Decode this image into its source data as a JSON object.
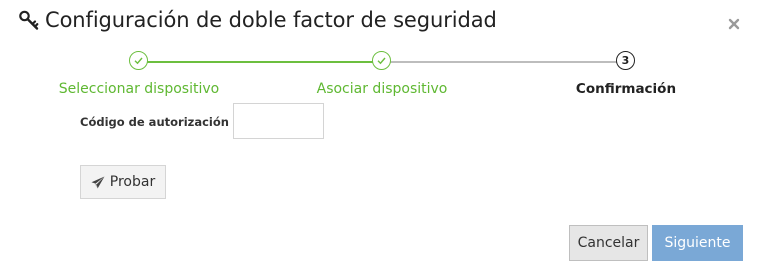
{
  "dialog": {
    "title": "Configuración de doble factor de seguridad",
    "title_icon": "key-icon",
    "close_icon": "close-icon"
  },
  "stepper": {
    "steps": [
      {
        "label": "Seleccionar dispositivo",
        "status": "completed",
        "marker": "check-icon"
      },
      {
        "label": "Asociar dispositivo",
        "status": "completed",
        "marker": "check-icon"
      },
      {
        "label": "Confirmación",
        "status": "current",
        "number": "3"
      }
    ],
    "completed_color": "#6cbf3f",
    "pending_color": "#bdbdbd"
  },
  "form": {
    "auth_code_label": "Código de autorización",
    "auth_code_value": "",
    "test_button_label": "Probar",
    "test_button_icon": "paper-plane-icon"
  },
  "footer": {
    "cancel_label": "Cancelar",
    "next_label": "Siguiente",
    "next_color": "#7aa8d6"
  }
}
